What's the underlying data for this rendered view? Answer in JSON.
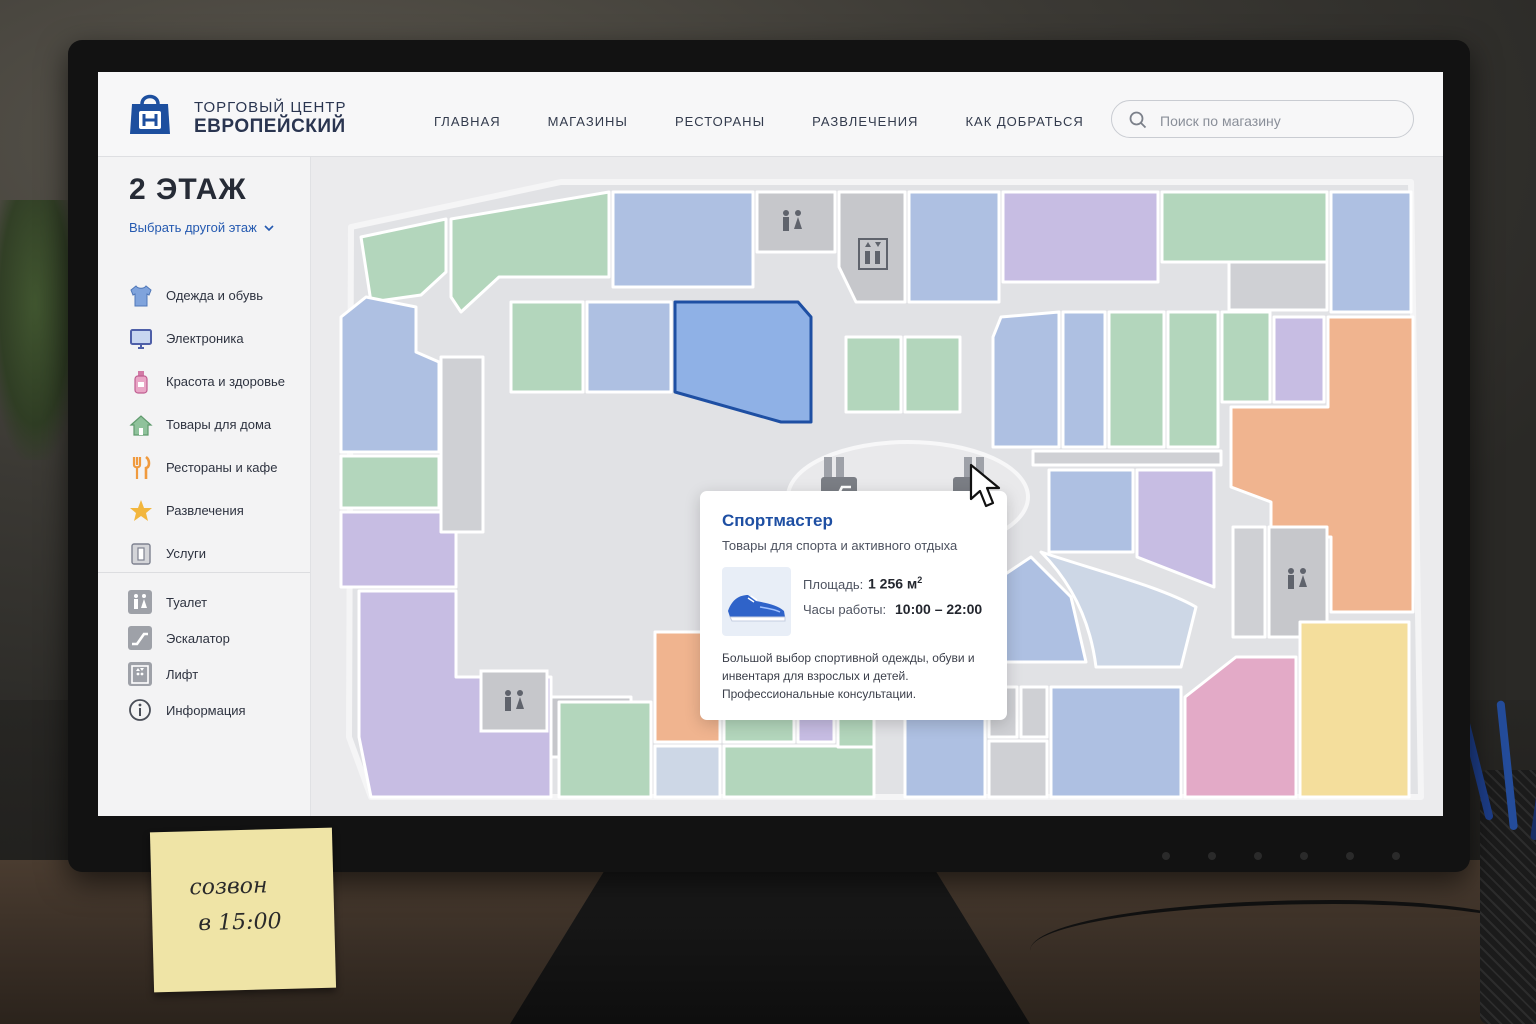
{
  "header": {
    "brand_line1": "ТОРГОВЫЙ ЦЕНТР",
    "brand_line2": "ЕВРОПЕЙСКИЙ",
    "nav": [
      "ГЛАВНАЯ",
      "МАГАЗИНЫ",
      "РЕСТОРАНЫ",
      "РАЗВЛЕЧЕНИЯ",
      "КАК ДОБРАТЬСЯ"
    ],
    "search_placeholder": "Поиск по магазину"
  },
  "sidebar": {
    "floor_title": "2 ЭТАЖ",
    "floor_select": "Выбрать другой этаж",
    "categories": [
      {
        "label": "Одежда и обувь",
        "icon": "tshirt-icon"
      },
      {
        "label": "Электроника",
        "icon": "monitor-icon"
      },
      {
        "label": "Красота и здоровье",
        "icon": "cosmetics-icon"
      },
      {
        "label": "Товары для дома",
        "icon": "house-icon"
      },
      {
        "label": "Рестораны и кафе",
        "icon": "fork-knife-icon"
      },
      {
        "label": "Развлечения",
        "icon": "star-icon"
      },
      {
        "label": "Услуги",
        "icon": "service-icon"
      }
    ],
    "legend": [
      {
        "label": "Туалет",
        "icon": "restroom-icon"
      },
      {
        "label": "Эскалатор",
        "icon": "escalator-icon"
      },
      {
        "label": "Лифт",
        "icon": "elevator-icon"
      },
      {
        "label": "Информация",
        "icon": "info-icon"
      }
    ]
  },
  "popup": {
    "title": "Спортмастер",
    "subtitle": "Товары для спорта и активного отдыха",
    "area_label": "Площадь:",
    "area_value": "1 256 м",
    "area_sup": "2",
    "hours_label": "Часы работы:",
    "hours_value": "10:00 – 22:00",
    "description": "Большой выбор спортивной одежды, обуви и инвентаря для взрослых и детей. Профессиональные консультации."
  },
  "zoom": {
    "plus": "+",
    "minus": "−"
  },
  "sticky_note": {
    "line1": "созвон",
    "line2": "в 15:00"
  },
  "colors": {
    "accent": "#1e4fa3",
    "clothing": "#a9c0e3",
    "electronics": "#a7d1b1",
    "beauty": "#c2b2dd",
    "food": "#f0b48f",
    "entertainment": "#f4de9c",
    "pink": "#e3aac7",
    "service": "#c7c8cc",
    "selected": "#8fb1e6"
  }
}
